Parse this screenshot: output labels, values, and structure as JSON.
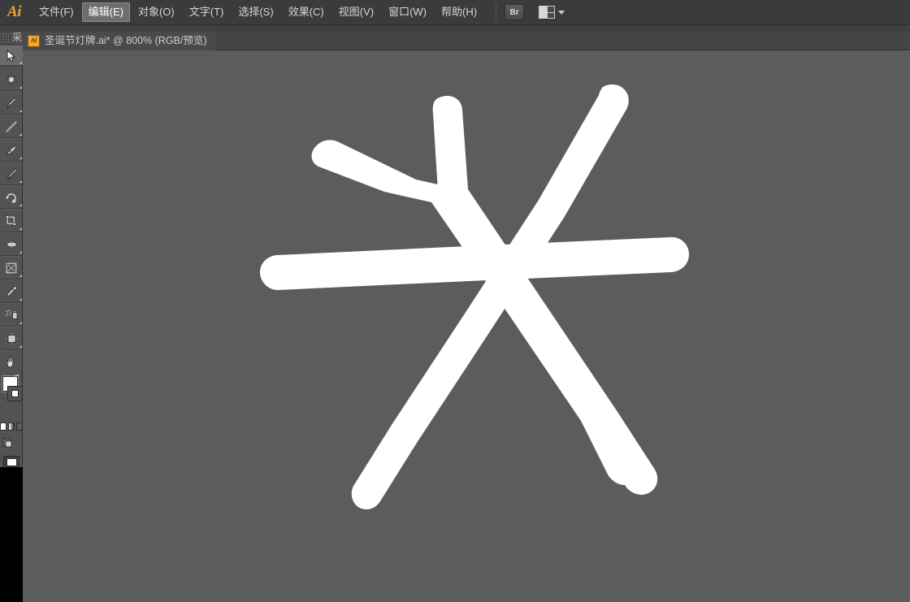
{
  "app": {
    "name": "Adobe Illustrator",
    "logo_text": "Ai"
  },
  "menubar": {
    "items": [
      {
        "label": "文件(F)",
        "name": "menu-file",
        "active": false
      },
      {
        "label": "编辑(E)",
        "name": "menu-edit",
        "active": true
      },
      {
        "label": "对象(O)",
        "name": "menu-object",
        "active": false
      },
      {
        "label": "文字(T)",
        "name": "menu-type",
        "active": false
      },
      {
        "label": "选择(S)",
        "name": "menu-select",
        "active": false
      },
      {
        "label": "效果(C)",
        "name": "menu-effect",
        "active": false
      },
      {
        "label": "视图(V)",
        "name": "menu-view",
        "active": false
      },
      {
        "label": "窗口(W)",
        "name": "menu-window",
        "active": false
      },
      {
        "label": "帮助(H)",
        "name": "menu-help",
        "active": false
      }
    ],
    "bridge_label": "Br",
    "arrange_tooltip": "排列文档"
  },
  "document_tab": {
    "title": "圣诞节灯牌.ai* @ 800% (RGB/预览)",
    "file_name": "圣诞节灯牌.ai",
    "modified": true,
    "zoom": "800%",
    "color_mode": "RGB",
    "view_mode": "预览",
    "icon_text": "Ai"
  },
  "toolbar": {
    "gripper_char": "采",
    "tools": [
      {
        "name": "selection-tool",
        "label": "选择工具",
        "active": true
      },
      {
        "name": "magic-wand-tool",
        "label": "魔棒工具",
        "active": false
      },
      {
        "name": "pen-tool",
        "label": "钢笔工具",
        "active": false
      },
      {
        "name": "line-segment-tool",
        "label": "直线段工具",
        "active": false
      },
      {
        "name": "paintbrush-tool",
        "label": "画笔工具",
        "active": false
      },
      {
        "name": "blob-brush-tool",
        "label": "斑点画笔工具",
        "active": false
      },
      {
        "name": "rotate-tool",
        "label": "旋转工具",
        "active": false
      },
      {
        "name": "scale-tool",
        "label": "比例缩放工具",
        "active": false
      },
      {
        "name": "width-tool",
        "label": "宽度工具",
        "active": false
      },
      {
        "name": "free-transform-tool",
        "label": "自由变换工具",
        "active": false
      },
      {
        "name": "eyedropper-tool",
        "label": "吸管工具",
        "active": false
      },
      {
        "name": "symbol-sprayer-tool",
        "label": "符号喷枪工具",
        "active": false
      },
      {
        "name": "artboard-tool",
        "label": "画板工具",
        "active": false
      },
      {
        "name": "hand-tool",
        "label": "抓手工具",
        "active": false
      }
    ],
    "fill_color": "#ffffff",
    "stroke_color": "#ffffff",
    "screen_mode_label": "更改屏幕模式",
    "draw_mode_label": "绘图模式"
  },
  "colors": {
    "canvas_background": "#5c5c5c",
    "artwork_fill": "#ffffff",
    "menubar_background": "#3b3b3b",
    "toolbar_background": "#535353",
    "tab_background": "#454545",
    "accent_orange": "#f0a830"
  },
  "artwork": {
    "name": "hand-drawn-snowflake",
    "description": "白色手绘雪花/星形图案",
    "stroke_count": 4,
    "fill": "#ffffff",
    "paths": [
      "M 537 122 C 552 113, 568 120, 569 135 L 576 233 L 668 370 L 760 507 L 806 578 C 814 592, 806 608, 790 609 C 781 609, 773 604, 769 597 L 723 525 L 632 388 L 540 252 L 533 140 C 532 132, 533 126, 537 122 Z",
      "M 388 181 C 395 172, 407 170, 417 175 L 512 221 L 566 233 L 660 366 L 751 500 L 785 568 C 792 583, 783 598, 767 597 C 759 596, 752 591, 748 584 L 715 518 L 624 384 L 531 249 L 473 236 L 392 205 C 382 200, 381 189, 388 181 Z",
      "M 342 357 C 330 357, 320 347, 320 335 C 320 324, 329 315, 341 314 L 576 303 L 825 292 C 838 291, 848 301, 848 313 C 848 325, 839 334, 826 335 L 577 346 Z",
      "M 742 107 C 754 100, 769 105, 773 118 C 775 125, 773 132, 769 138 L 694 268 L 603 408 L 513 545 L 468 617 C 460 630, 443 630, 436 619 C 431 611, 432 602, 437 595 L 482 523 L 572 386 L 663 246 L 737 117 C 738 113, 740 109, 742 107 Z"
    ]
  }
}
